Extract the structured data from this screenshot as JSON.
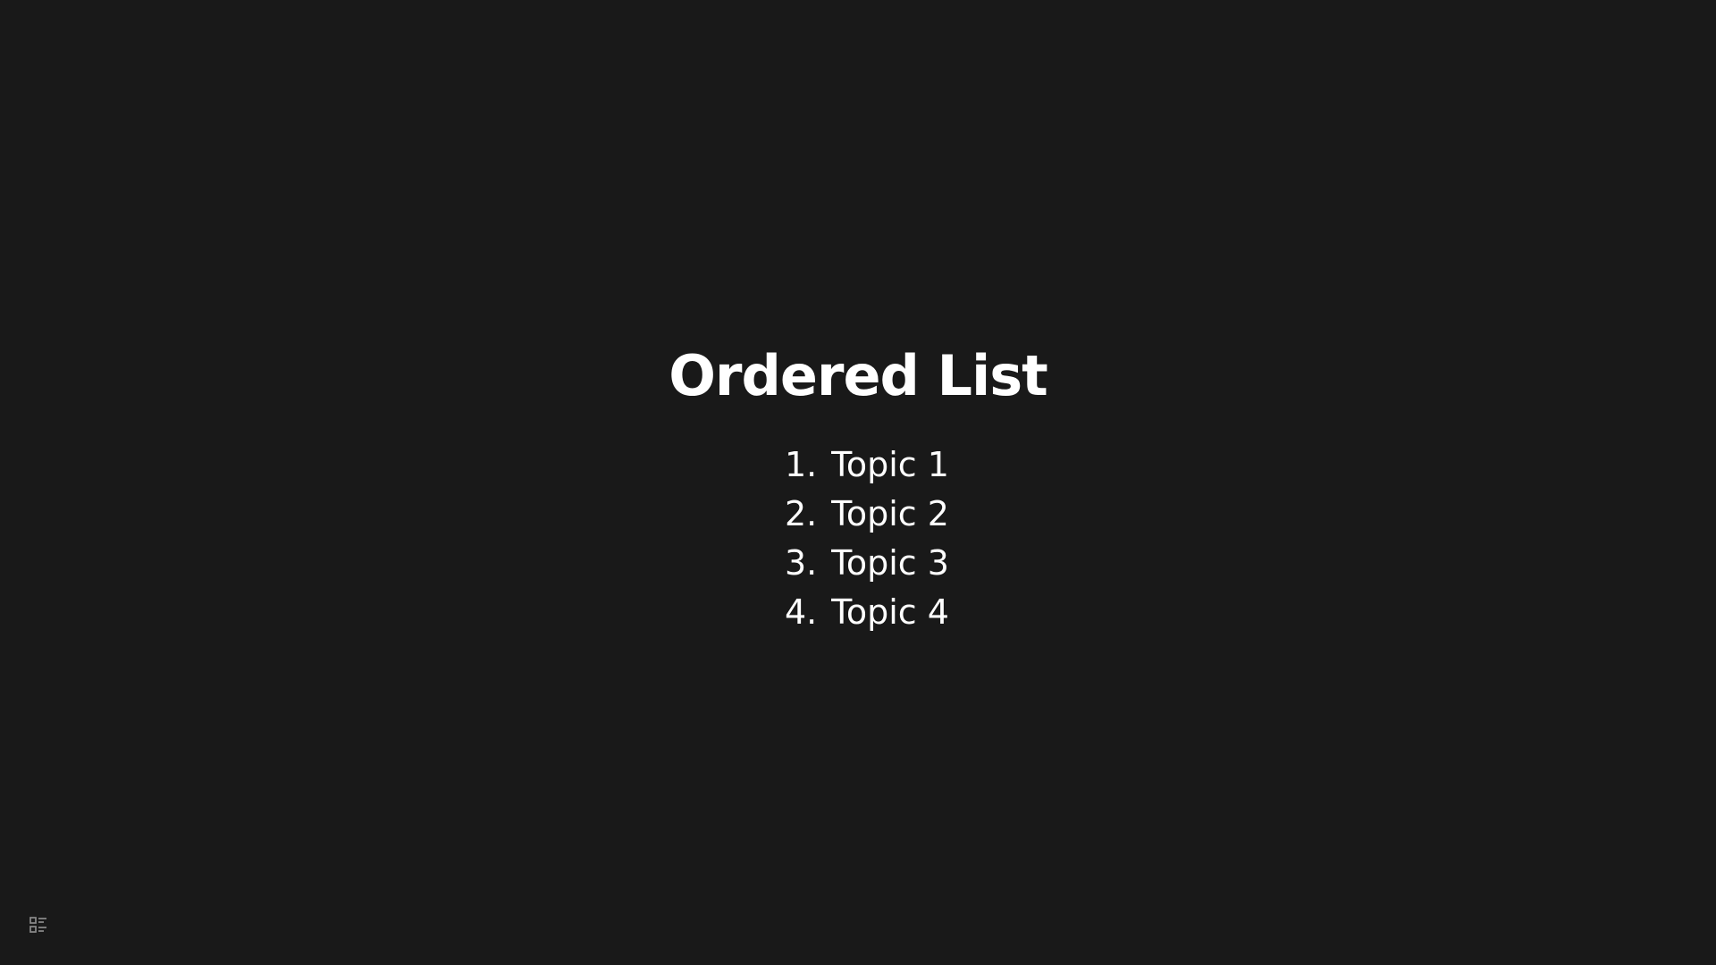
{
  "slide": {
    "title": "Ordered List",
    "items": [
      {
        "number": "1.",
        "label": "Topic 1"
      },
      {
        "number": "2.",
        "label": "Topic 2"
      },
      {
        "number": "3.",
        "label": "Topic 3"
      },
      {
        "number": "4.",
        "label": "Topic 4"
      }
    ]
  },
  "controls": {
    "menu_icon": "table-of-contents-icon"
  },
  "colors": {
    "background": "#191919",
    "text": "#ffffff",
    "icon": "#8b8b8b"
  }
}
